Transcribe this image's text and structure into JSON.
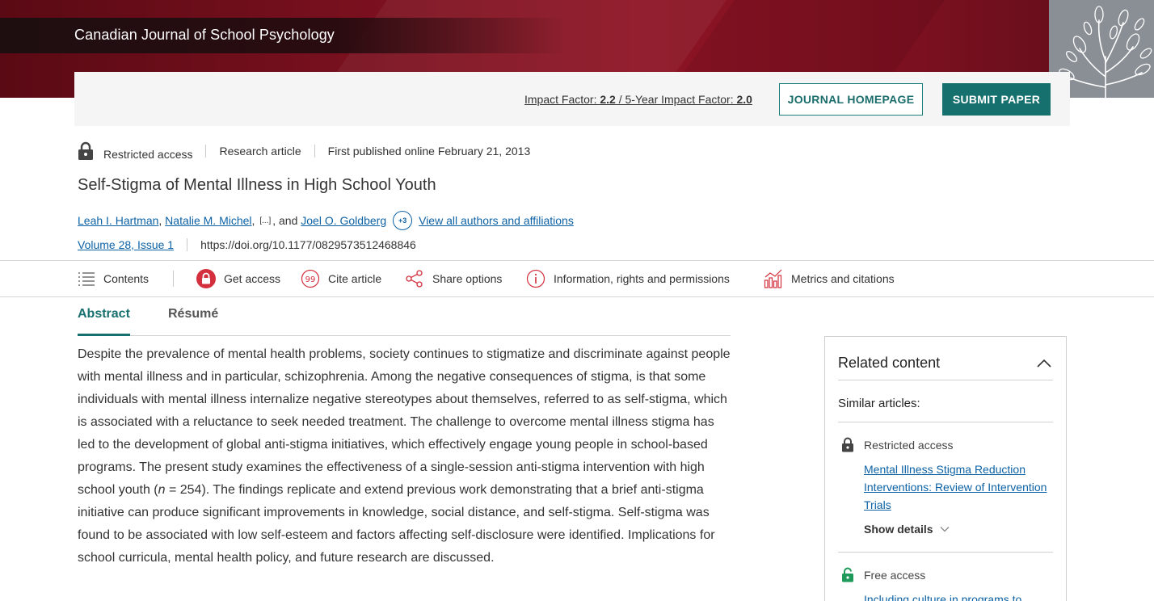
{
  "header": {
    "journal_title": "Canadian Journal of School Psychology"
  },
  "impact": {
    "impact_label": "Impact Factor: ",
    "impact_value": "2.2",
    "separator": " / ",
    "five_year_label": "5-Year Impact Factor: ",
    "five_year_value": "2.0",
    "journal_homepage": "JOURNAL HOMEPAGE",
    "submit_paper": "SUBMIT PAPER"
  },
  "meta": {
    "access": "Restricted access",
    "type": "Research article",
    "published": "First published online February 21, 2013"
  },
  "article": {
    "title": "Self-Stigma of Mental Illness in High School Youth",
    "authors": [
      "Leah I. Hartman",
      "Natalie M. Michel",
      "Joel O. Goldberg"
    ],
    "authors_ellipsis": "[...]",
    "and_text": ", and",
    "more_count": "+3",
    "view_all": "View all authors and affiliations",
    "volume_issue": "Volume 28, Issue 1",
    "doi": "https://doi.org/10.1177/0829573512468846"
  },
  "toolbar": {
    "contents": "Contents",
    "get_access": "Get access",
    "cite": "Cite article",
    "share": "Share options",
    "info": "Information, rights and permissions",
    "metrics": "Metrics and citations"
  },
  "tabs": {
    "abstract": "Abstract",
    "resume": "Résumé"
  },
  "abstract": {
    "part1": "Despite the prevalence of mental health problems, society continues to stigmatize and discriminate against people with mental illness and in particular, schizophrenia. Among the negative consequences of stigma, is that some individuals with mental illness internalize negative stereotypes about themselves, referred to as self-stigma, which is associated with a reluctance to seek needed treatment. The challenge to overcome mental illness stigma has led to the development of global anti-stigma initiatives, which effectively engage young people in school-based programs. The present study examines the effectiveness of a single-session anti-stigma intervention with high school youth (",
    "n_italic": "n",
    "part2": " = 254). The findings replicate and extend previous work demonstrating that a brief anti-stigma initiative can produce significant improvements in knowledge, social distance, and self-stigma. Self-stigma was found to be associated with low self-esteem and factors affecting self-disclosure were identified. Implications for school curricula, mental health policy, and future research are discussed."
  },
  "related": {
    "title": "Related content",
    "similar": "Similar articles:",
    "items": [
      {
        "access": "Restricted access",
        "title": "Mental Illness Stigma Reduction Interventions: Review of Intervention Trials",
        "show_details": "Show details"
      },
      {
        "access": "Free access",
        "title": "Including culture in programs to"
      }
    ]
  },
  "colors": {
    "brand_red": "#8e1424",
    "teal": "#16706e",
    "link_blue": "#0d62a5"
  }
}
